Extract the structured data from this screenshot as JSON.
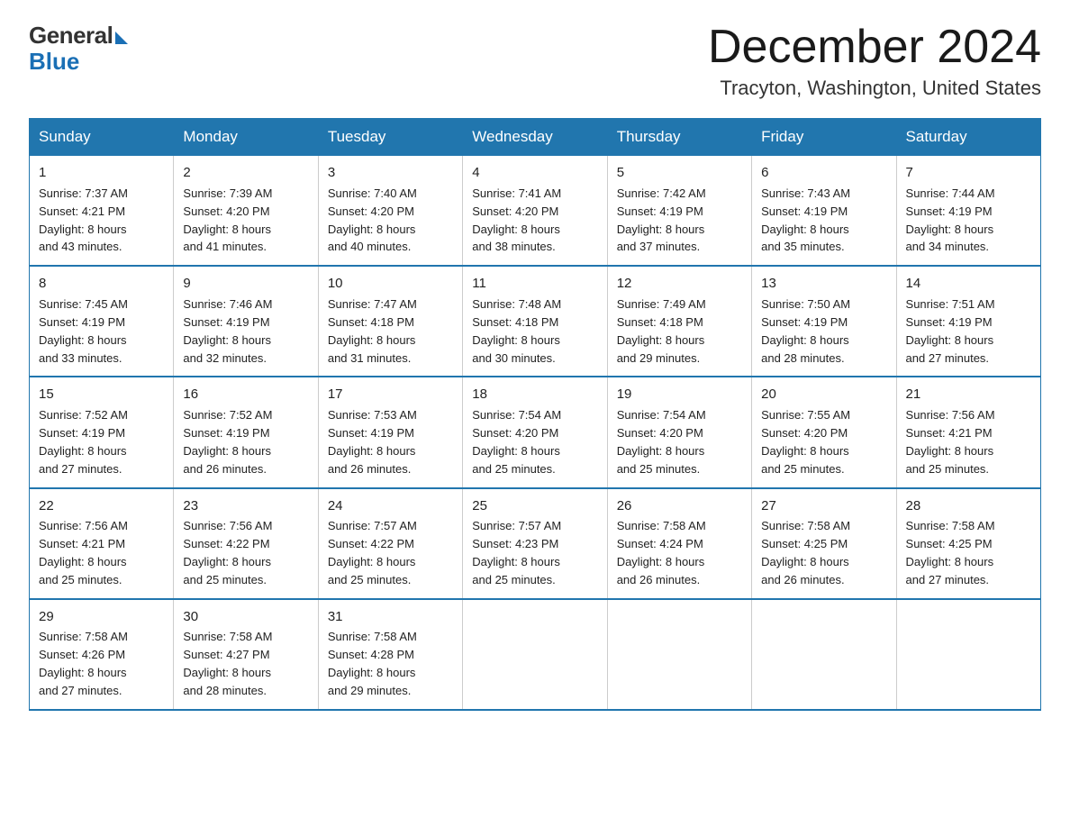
{
  "header": {
    "logo_general": "General",
    "logo_blue": "Blue",
    "month_title": "December 2024",
    "location": "Tracyton, Washington, United States"
  },
  "days_of_week": [
    "Sunday",
    "Monday",
    "Tuesday",
    "Wednesday",
    "Thursday",
    "Friday",
    "Saturday"
  ],
  "weeks": [
    [
      {
        "day": "1",
        "sunrise": "7:37 AM",
        "sunset": "4:21 PM",
        "daylight_h": "8",
        "daylight_m": "43"
      },
      {
        "day": "2",
        "sunrise": "7:39 AM",
        "sunset": "4:20 PM",
        "daylight_h": "8",
        "daylight_m": "41"
      },
      {
        "day": "3",
        "sunrise": "7:40 AM",
        "sunset": "4:20 PM",
        "daylight_h": "8",
        "daylight_m": "40"
      },
      {
        "day": "4",
        "sunrise": "7:41 AM",
        "sunset": "4:20 PM",
        "daylight_h": "8",
        "daylight_m": "38"
      },
      {
        "day": "5",
        "sunrise": "7:42 AM",
        "sunset": "4:19 PM",
        "daylight_h": "8",
        "daylight_m": "37"
      },
      {
        "day": "6",
        "sunrise": "7:43 AM",
        "sunset": "4:19 PM",
        "daylight_h": "8",
        "daylight_m": "35"
      },
      {
        "day": "7",
        "sunrise": "7:44 AM",
        "sunset": "4:19 PM",
        "daylight_h": "8",
        "daylight_m": "34"
      }
    ],
    [
      {
        "day": "8",
        "sunrise": "7:45 AM",
        "sunset": "4:19 PM",
        "daylight_h": "8",
        "daylight_m": "33"
      },
      {
        "day": "9",
        "sunrise": "7:46 AM",
        "sunset": "4:19 PM",
        "daylight_h": "8",
        "daylight_m": "32"
      },
      {
        "day": "10",
        "sunrise": "7:47 AM",
        "sunset": "4:18 PM",
        "daylight_h": "8",
        "daylight_m": "31"
      },
      {
        "day": "11",
        "sunrise": "7:48 AM",
        "sunset": "4:18 PM",
        "daylight_h": "8",
        "daylight_m": "30"
      },
      {
        "day": "12",
        "sunrise": "7:49 AM",
        "sunset": "4:18 PM",
        "daylight_h": "8",
        "daylight_m": "29"
      },
      {
        "day": "13",
        "sunrise": "7:50 AM",
        "sunset": "4:19 PM",
        "daylight_h": "8",
        "daylight_m": "28"
      },
      {
        "day": "14",
        "sunrise": "7:51 AM",
        "sunset": "4:19 PM",
        "daylight_h": "8",
        "daylight_m": "27"
      }
    ],
    [
      {
        "day": "15",
        "sunrise": "7:52 AM",
        "sunset": "4:19 PM",
        "daylight_h": "8",
        "daylight_m": "27"
      },
      {
        "day": "16",
        "sunrise": "7:52 AM",
        "sunset": "4:19 PM",
        "daylight_h": "8",
        "daylight_m": "26"
      },
      {
        "day": "17",
        "sunrise": "7:53 AM",
        "sunset": "4:19 PM",
        "daylight_h": "8",
        "daylight_m": "26"
      },
      {
        "day": "18",
        "sunrise": "7:54 AM",
        "sunset": "4:20 PM",
        "daylight_h": "8",
        "daylight_m": "25"
      },
      {
        "day": "19",
        "sunrise": "7:54 AM",
        "sunset": "4:20 PM",
        "daylight_h": "8",
        "daylight_m": "25"
      },
      {
        "day": "20",
        "sunrise": "7:55 AM",
        "sunset": "4:20 PM",
        "daylight_h": "8",
        "daylight_m": "25"
      },
      {
        "day": "21",
        "sunrise": "7:56 AM",
        "sunset": "4:21 PM",
        "daylight_h": "8",
        "daylight_m": "25"
      }
    ],
    [
      {
        "day": "22",
        "sunrise": "7:56 AM",
        "sunset": "4:21 PM",
        "daylight_h": "8",
        "daylight_m": "25"
      },
      {
        "day": "23",
        "sunrise": "7:56 AM",
        "sunset": "4:22 PM",
        "daylight_h": "8",
        "daylight_m": "25"
      },
      {
        "day": "24",
        "sunrise": "7:57 AM",
        "sunset": "4:22 PM",
        "daylight_h": "8",
        "daylight_m": "25"
      },
      {
        "day": "25",
        "sunrise": "7:57 AM",
        "sunset": "4:23 PM",
        "daylight_h": "8",
        "daylight_m": "25"
      },
      {
        "day": "26",
        "sunrise": "7:58 AM",
        "sunset": "4:24 PM",
        "daylight_h": "8",
        "daylight_m": "26"
      },
      {
        "day": "27",
        "sunrise": "7:58 AM",
        "sunset": "4:25 PM",
        "daylight_h": "8",
        "daylight_m": "26"
      },
      {
        "day": "28",
        "sunrise": "7:58 AM",
        "sunset": "4:25 PM",
        "daylight_h": "8",
        "daylight_m": "27"
      }
    ],
    [
      {
        "day": "29",
        "sunrise": "7:58 AM",
        "sunset": "4:26 PM",
        "daylight_h": "8",
        "daylight_m": "27"
      },
      {
        "day": "30",
        "sunrise": "7:58 AM",
        "sunset": "4:27 PM",
        "daylight_h": "8",
        "daylight_m": "28"
      },
      {
        "day": "31",
        "sunrise": "7:58 AM",
        "sunset": "4:28 PM",
        "daylight_h": "8",
        "daylight_m": "29"
      },
      null,
      null,
      null,
      null
    ]
  ]
}
